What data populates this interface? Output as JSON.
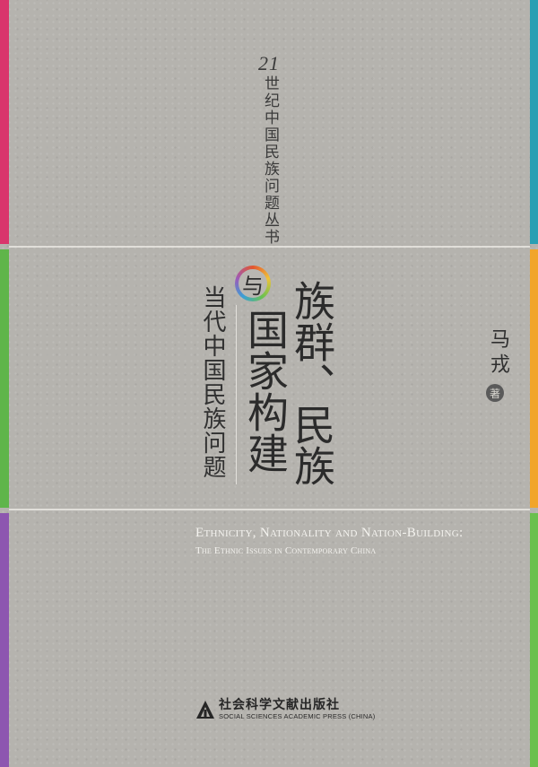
{
  "colors": {
    "stripe_left_top": "#d9356c",
    "stripe_left_middle": "#5fb54a",
    "stripe_left_bottom": "#8d56b0",
    "stripe_right_top": "#2a9fb3",
    "stripe_right_middle": "#f1a52a",
    "stripe_right_bottom": "#6bc04e",
    "cover_background": "#b5b3ae"
  },
  "series": {
    "number": "21",
    "title": "世纪中国民族问题丛书"
  },
  "title": {
    "line1": "族群、民族",
    "conjunction": "与",
    "line2": "国家构建"
  },
  "subtitle": "当代中国民族问题",
  "author": {
    "name": "马戎",
    "role": "著"
  },
  "english": {
    "title": "Ethnicity, Nationality and Nation-Building:",
    "subtitle": "The Ethnic Issues in Contemporary China"
  },
  "publisher": {
    "name": "社会科学文献出版社",
    "name_en": "SOCIAL SCIENCES ACADEMIC PRESS (CHINA)"
  }
}
